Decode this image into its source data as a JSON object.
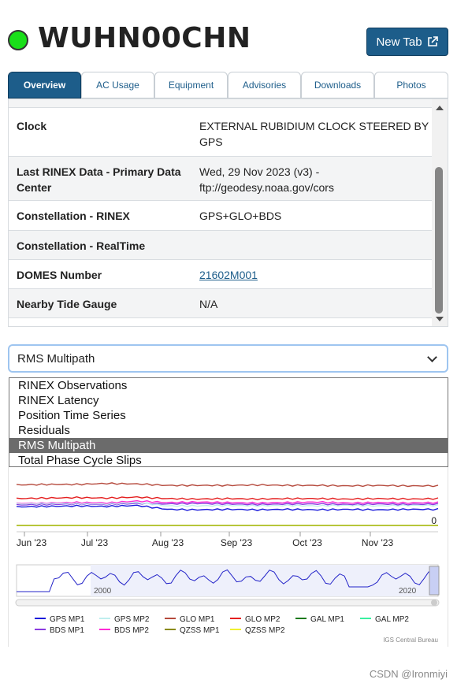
{
  "station": {
    "name": "WUHN00CHN",
    "status_color": "#1adf1a"
  },
  "header": {
    "new_tab_label": "New Tab"
  },
  "tabs": [
    {
      "label": "Overview"
    },
    {
      "label": "AC Usage"
    },
    {
      "label": "Equipment"
    },
    {
      "label": "Advisories"
    },
    {
      "label": "Downloads"
    },
    {
      "label": "Photos"
    }
  ],
  "info_rows": [
    {
      "label": "Clock",
      "value_l1": "EXTERNAL RUBIDIUM CLOCK STEERED BY",
      "value_l2": "GPS"
    },
    {
      "label_l1": "Last RINEX Data - Primary Data",
      "label_l2": "Center",
      "value_l1": "Wed, 29 Nov 2023 (v3) -",
      "value_l2": "ftp://geodesy.noaa.gov/cors"
    },
    {
      "label": "Constellation - RINEX",
      "value": "GPS+GLO+BDS"
    },
    {
      "label": "Constellation - RealTime",
      "value": ""
    },
    {
      "label": "DOMES Number",
      "value": "21602M001"
    },
    {
      "label": "Nearby Tide Gauge",
      "value": "N/A"
    }
  ],
  "plot_select": {
    "value": "RMS Multipath",
    "options": [
      "RINEX Observations",
      "RINEX Latency",
      "Position Time Series",
      "Residuals",
      "RMS Multipath",
      "Total Phase Cycle Slips"
    ]
  },
  "chart_data": {
    "type": "line",
    "x": [
      "Jun '23",
      "Jul '23",
      "Aug '23",
      "Sep '23",
      "Oct '23",
      "Nov '23"
    ],
    "y_tick_labels": [
      "0"
    ],
    "navigator_labels": [
      "2000",
      "2020"
    ],
    "legend_rows": [
      [
        {
          "name": "GPS MP1",
          "color": "#1a1adb"
        },
        {
          "name": "GPS MP2",
          "color": "#bfeeee"
        },
        {
          "name": "GLO MP1",
          "color": "#b5493c"
        },
        {
          "name": "GLO MP2",
          "color": "#e41f1f"
        },
        {
          "name": "GAL MP1",
          "color": "#1d7a1d"
        },
        {
          "name": "GAL MP2",
          "color": "#39f0a0"
        }
      ],
      [
        {
          "name": "BDS MP1",
          "color": "#8a3be0"
        },
        {
          "name": "BDS MP2",
          "color": "#ff2bd6"
        },
        {
          "name": "QZSS MP1",
          "color": "#8a8a10"
        },
        {
          "name": "QZSS MP2",
          "color": "#f0f030"
        }
      ]
    ],
    "series": [
      {
        "name": "GLO MP1",
        "color": "#b5493c",
        "values": [
          0.83,
          0.84,
          0.84,
          0.86,
          0.85,
          0.82,
          0.82,
          0.82,
          0.83,
          0.82,
          0.82,
          0.81,
          0.82,
          0.81,
          0.81
        ]
      },
      {
        "name": "GLO MP2",
        "color": "#e41f1f",
        "values": [
          0.55,
          0.56,
          0.57,
          0.56,
          0.58,
          0.55,
          0.54,
          0.55,
          0.54,
          0.55,
          0.55,
          0.54,
          0.55,
          0.54,
          0.55
        ]
      },
      {
        "name": "BDS MP2",
        "color": "#ff2bd6",
        "values": [
          0.45,
          0.46,
          0.47,
          0.46,
          0.5,
          0.47,
          0.48,
          0.47,
          0.46,
          0.47,
          0.48,
          0.46,
          0.47,
          0.46,
          0.47
        ]
      },
      {
        "name": "BDS MP1",
        "color": "#8a3be0",
        "values": [
          0.42,
          0.43,
          0.44,
          0.43,
          0.45,
          0.44,
          0.45,
          0.44,
          0.43,
          0.44,
          0.44,
          0.43,
          0.44,
          0.43,
          0.44
        ]
      },
      {
        "name": "GPS MP1",
        "color": "#1a1adb",
        "values": [
          0.38,
          0.39,
          0.4,
          0.39,
          0.41,
          0.33,
          0.32,
          0.33,
          0.32,
          0.33,
          0.32,
          0.33,
          0.32,
          0.33,
          0.33
        ]
      },
      {
        "name": "GPS MP2",
        "color": "#bfeeee",
        "values": [
          0.44,
          0.45,
          0.45,
          0.44,
          0.47,
          0.4,
          0.4,
          0.41,
          0.4,
          0.41,
          0.4,
          0.41,
          0.4,
          0.41,
          0.41
        ]
      },
      {
        "name": "QZSS MP1",
        "color": "#8a8a10",
        "values": [
          0.0,
          0.0,
          0.0,
          0.0,
          0.0,
          0.0,
          0.0,
          0.0,
          0.0,
          0.0,
          0.0,
          0.0,
          0.0,
          0.0,
          0.0
        ]
      }
    ],
    "credit": "IGS Central Bureau"
  },
  "watermark": "CSDN @Ironmiyi"
}
